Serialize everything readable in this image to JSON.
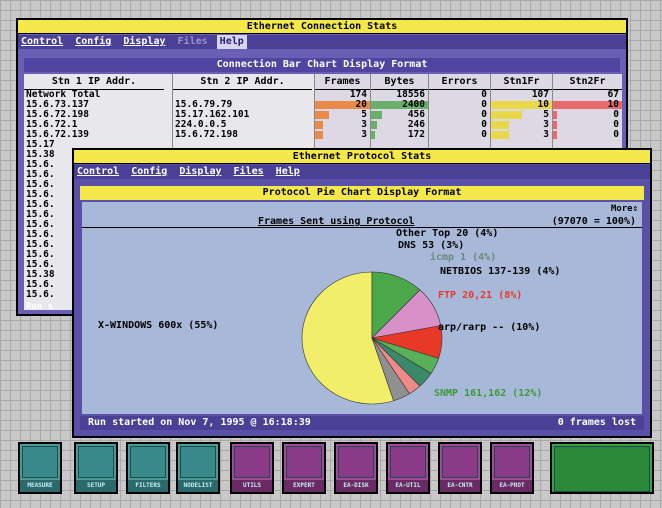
{
  "win1": {
    "title": "Ethernet Connection Stats",
    "menu": [
      "Control",
      "Config",
      "Display",
      "Files",
      "Help"
    ],
    "subtitle": "Connection Bar Chart Display Format",
    "headers": {
      "stn1": "Stn 1 IP  Addr.",
      "stn2": "Stn 2 IP Addr.",
      "frames": "Frames",
      "bytes": "Bytes",
      "errors": "Errors",
      "stn1fr": "Stn1Fr",
      "stn2fr": "Stn2Fr"
    },
    "stn1": [
      "Network Total",
      "15.6.73.137",
      "15.6.72.198",
      "15.6.72.1",
      "15.6.72.139",
      "15.17",
      "15.38",
      "15.6.",
      "15.6.",
      "15.6.",
      "15.6.",
      "15.6.",
      "15.6.",
      "15.6.",
      "15.6.",
      "15.6.",
      "15.6.",
      "15.6.",
      "15.38",
      "15.6.",
      "15.6."
    ],
    "stn2": [
      "",
      "15.6.79.79",
      "15.17.162.101",
      "224.0.0.5",
      "15.6.72.198"
    ],
    "frames": [
      "174",
      "20",
      "5",
      "3",
      "3"
    ],
    "bytes": [
      "18556",
      "2400",
      "456",
      "246",
      "172"
    ],
    "errors": [
      "0",
      "0",
      "0",
      "0",
      "0"
    ],
    "stn1fr": [
      "107",
      "10",
      "5",
      "3",
      "3"
    ],
    "stn2fr": [
      "67",
      "10",
      "0",
      "0",
      "0"
    ],
    "run_label": "Run s"
  },
  "win2": {
    "title": "Ethernet Protocol Stats",
    "menu": [
      "Control",
      "Config",
      "Display",
      "Files",
      "Help"
    ],
    "subtitle": "Protocol Pie Chart Display Format",
    "more": "More",
    "chart_title": "Frames Sent using Protocol",
    "total": "(97070 = 100%)",
    "status_left": "Run started on Nov  7, 1995 @ 16:18:39",
    "status_right": "0 frames lost"
  },
  "taskbar": {
    "buttons": [
      "MEASURE",
      "SETUP",
      "FILTERS",
      "NODELIST",
      "UTILS",
      "EXPERT",
      "EA-DISK",
      "EA-UTIL",
      "EA-CNTR",
      "EA-PROT"
    ]
  },
  "colors": {
    "x_windows": "#f2ee6a",
    "snmp": "#4aa84a",
    "arp": "#d890c8",
    "ftp": "#e83828",
    "netbios": "#58b058",
    "icmp": "#3a8a6a",
    "dns": "#f08a8a",
    "other": "#909090"
  },
  "chart_data": {
    "type": "pie",
    "title": "Frames Sent using Protocol",
    "slices": [
      {
        "label": "X-WINDOWS 600x (55%)",
        "value": 55
      },
      {
        "label": "SNMP 161,162 (12%)",
        "value": 12
      },
      {
        "label": "arp/rarp -- (10%)",
        "value": 10
      },
      {
        "label": "FTP 20,21 (8%)",
        "value": 8
      },
      {
        "label": "NETBIOS 137-139 (4%)",
        "value": 4
      },
      {
        "label": "icmp 1 (4%)",
        "value": 4
      },
      {
        "label": "DNS 53 (3%)",
        "value": 3
      },
      {
        "label": "Other Top 20 (4%)",
        "value": 4
      }
    ]
  }
}
